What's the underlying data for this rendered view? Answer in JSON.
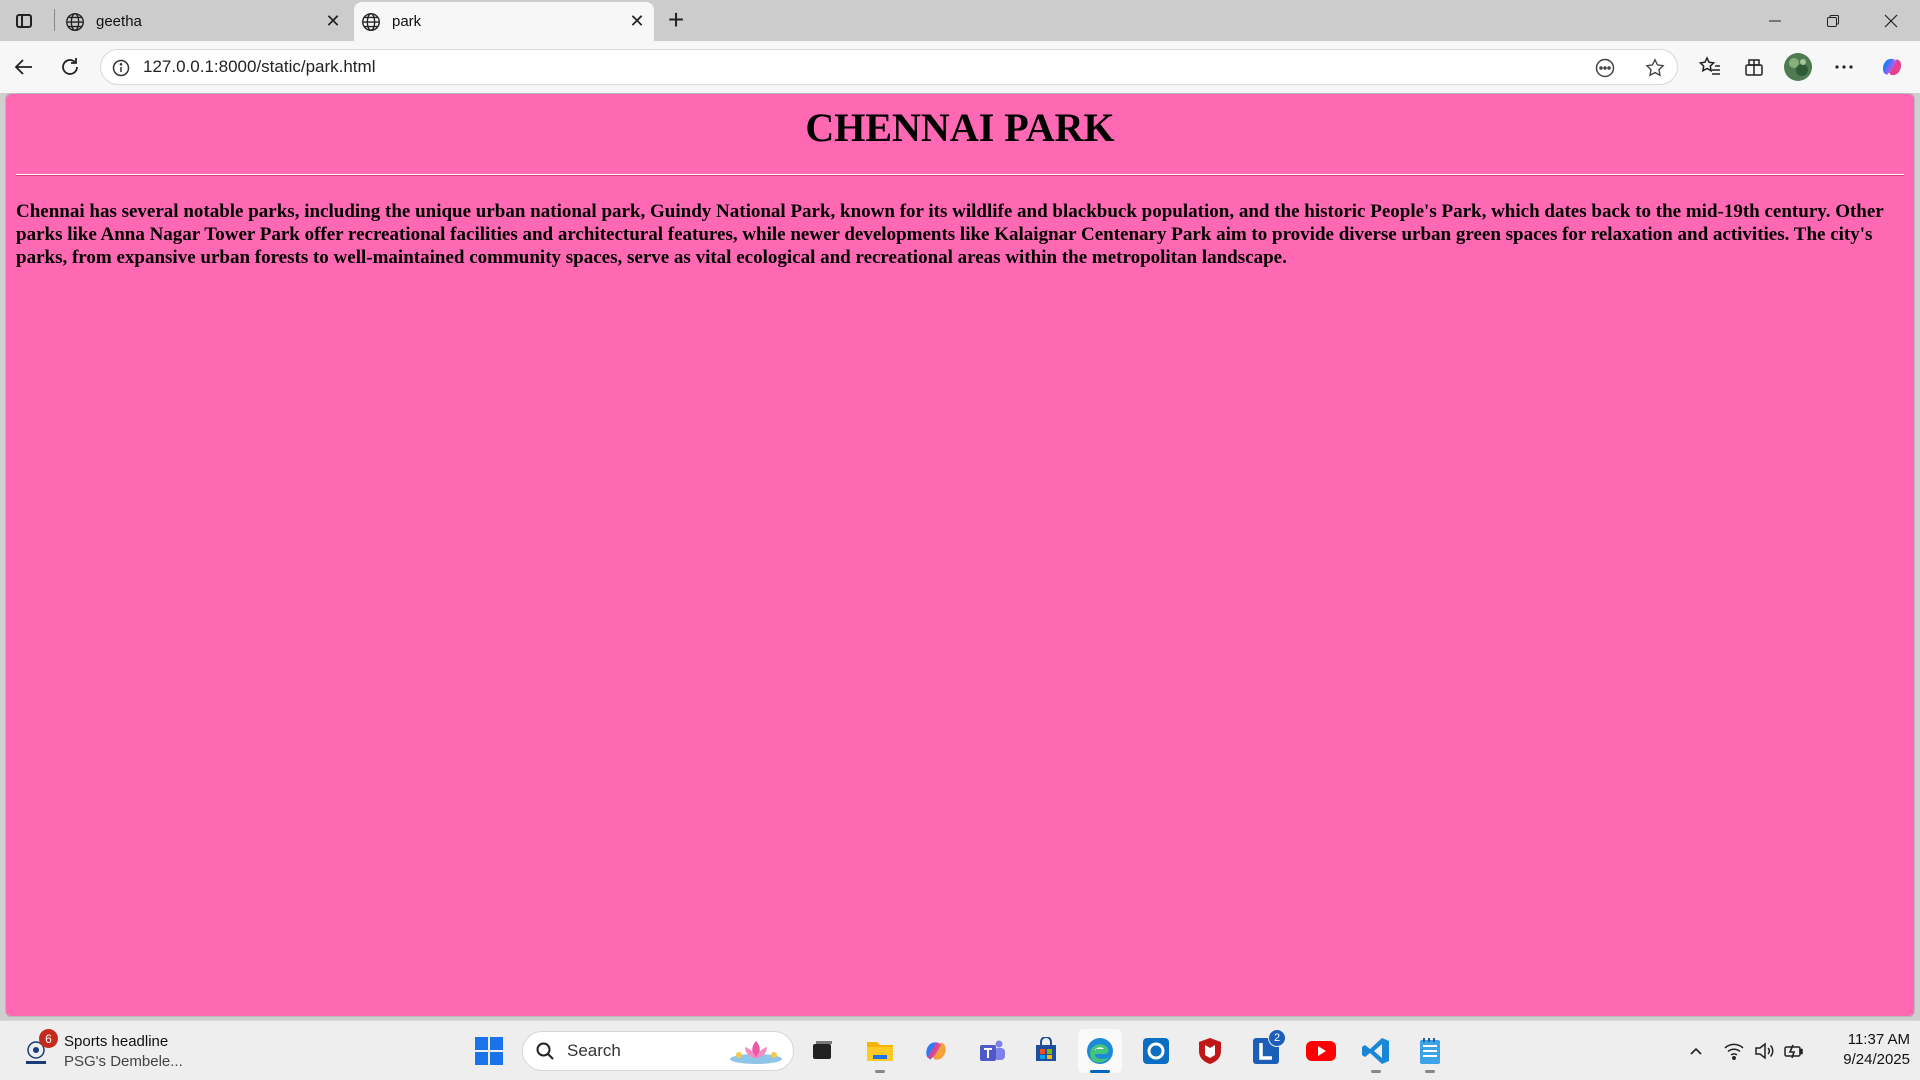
{
  "browser": {
    "tabs": [
      {
        "title": "geetha",
        "active": false
      },
      {
        "title": "park",
        "active": true
      }
    ],
    "address": {
      "url": "127.0.0.1:8000/static/park.html"
    }
  },
  "page": {
    "background": "#ff69b4",
    "heading": "CHENNAI PARK",
    "paragraph": "Chennai has several notable parks, including the unique urban national park, Guindy National Park, known for its wildlife and blackbuck population, and the historic People's Park, which dates back to the mid-19th century. Other parks like Anna Nagar Tower Park offer recreational facilities and architectural features, while newer developments like Kalaignar Centenary Park aim to provide diverse urban green spaces for relaxation and activities. The city's parks, from expansive urban forests to well-maintained community spaces, serve as vital ecological and recreational areas within the metropolitan landscape."
  },
  "taskbar": {
    "widget": {
      "badge": "6",
      "headline": "Sports headline",
      "subtext": "PSG's Dembele..."
    },
    "search": {
      "label": "Search"
    },
    "apps": [
      "start",
      "search",
      "task-view",
      "file-explorer",
      "copilot",
      "teams",
      "microsoft-store",
      "edge",
      "cortana",
      "mcafee",
      "l-app",
      "youtube",
      "vscode",
      "notepad"
    ],
    "l_app_badge": "2",
    "clock": {
      "time": "11:37 AM",
      "date": "9/24/2025"
    }
  },
  "colors": {
    "accent": "#0067c0",
    "page_bg": "#ff69b4"
  }
}
